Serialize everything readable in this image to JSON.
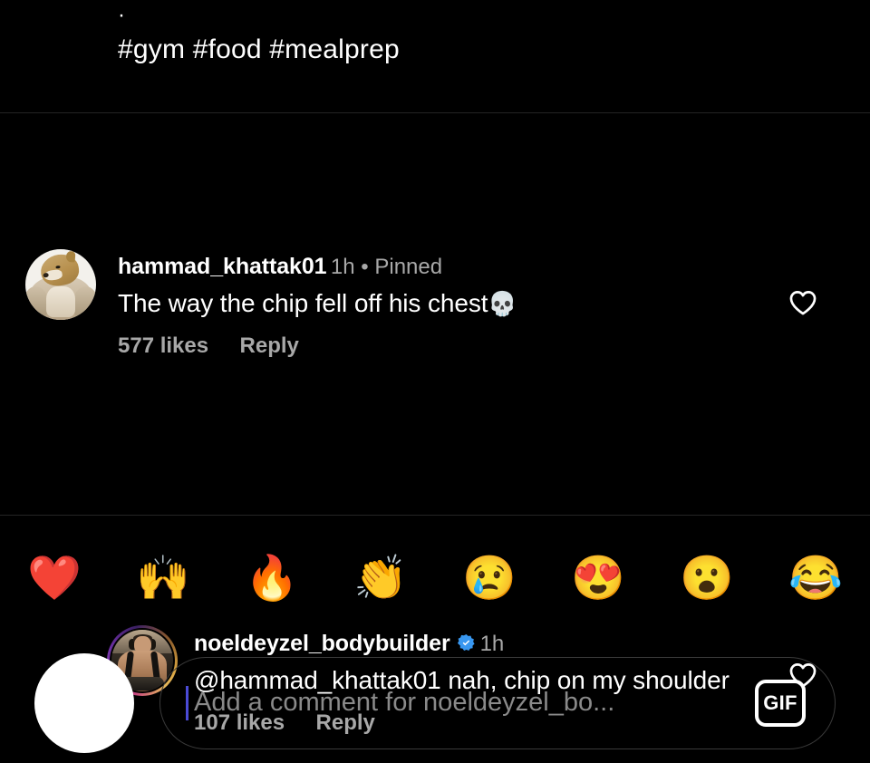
{
  "post": {
    "caption_dot": "·",
    "hashtags": "#gym #food #mealprep"
  },
  "comments": [
    {
      "username": "hammad_khattak01",
      "verified": false,
      "time": "1h",
      "meta_separator": "•",
      "pinned_label": "Pinned",
      "meta": "1h • Pinned",
      "text": "The way the chip fell off his chest",
      "emoji": "💀",
      "likes": "577 likes",
      "reply": "Reply",
      "avatar_name": "shiba-bodybuilder-avatar",
      "like_icon": "heart-outline-icon"
    },
    {
      "username": "noeldeyzel_bodybuilder",
      "verified": true,
      "time": "1h",
      "meta": "1h",
      "mention": "@hammad_khattak01",
      "text": "@hammad_khattak01 nah, chip on my shoulder",
      "likes": "107 likes",
      "reply": "Reply",
      "avatar_name": "noeldeyzel-avatar",
      "like_icon": "heart-outline-icon"
    }
  ],
  "emoji_bar": [
    {
      "name": "red-heart-emoji",
      "glyph": "❤️"
    },
    {
      "name": "raising-hands-emoji",
      "glyph": "🙌"
    },
    {
      "name": "fire-emoji",
      "glyph": "🔥"
    },
    {
      "name": "clapping-hands-emoji",
      "glyph": "👏"
    },
    {
      "name": "crying-face-emoji",
      "glyph": "😢"
    },
    {
      "name": "heart-eyes-emoji",
      "glyph": "😍"
    },
    {
      "name": "open-mouth-emoji",
      "glyph": "😮"
    },
    {
      "name": "joy-emoji",
      "glyph": "😂"
    }
  ],
  "composer": {
    "placeholder": "Add a comment for noeldeyzel_bo...",
    "gif_label": "GIF",
    "value": ""
  },
  "colors": {
    "background": "#000000",
    "text_primary": "#ffffff",
    "text_secondary": "#a8a8a8",
    "placeholder": "#8a8a8a",
    "divider": "#242424",
    "verified_blue": "#3897f0",
    "caret": "#4b4bd6"
  }
}
